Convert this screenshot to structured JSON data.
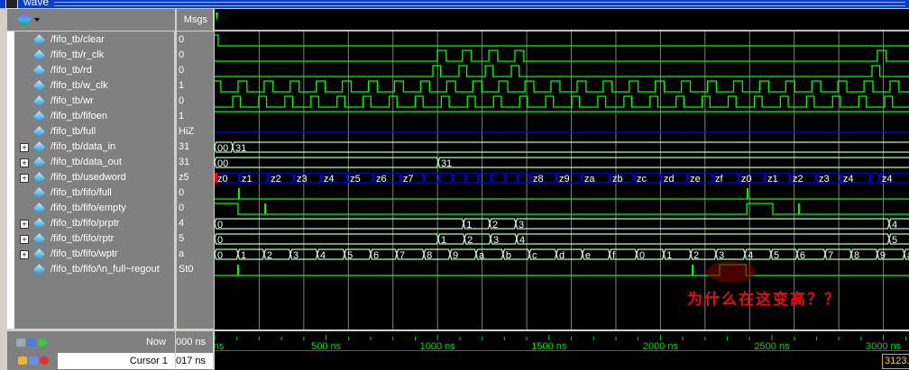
{
  "window": {
    "title": "wave"
  },
  "header": {
    "msgs_label": "Msgs"
  },
  "signals": [
    {
      "name": "/fifo_tb/clear",
      "value": "0",
      "expandable": false
    },
    {
      "name": "/fifo_tb/r_clk",
      "value": "0",
      "expandable": false
    },
    {
      "name": "/fifo_tb/rd",
      "value": "0",
      "expandable": false
    },
    {
      "name": "/fifo_tb/w_clk",
      "value": "1",
      "expandable": false
    },
    {
      "name": "/fifo_tb/wr",
      "value": "0",
      "expandable": false
    },
    {
      "name": "/fifo_tb/fifoen",
      "value": "1",
      "expandable": false
    },
    {
      "name": "/fifo_tb/full",
      "value": "HiZ",
      "expandable": false
    },
    {
      "name": "/fifo_tb/data_in",
      "value": "31",
      "expandable": true
    },
    {
      "name": "/fifo_tb/data_out",
      "value": "31",
      "expandable": true
    },
    {
      "name": "/fifo_tb/usedword",
      "value": "z5",
      "expandable": true
    },
    {
      "name": "/fifo_tb/fifo/full",
      "value": "0",
      "expandable": false
    },
    {
      "name": "/fifo_tb/fifo/empty",
      "value": "0",
      "expandable": false
    },
    {
      "name": "/fifo_tb/fifo/prptr",
      "value": "4",
      "expandable": true
    },
    {
      "name": "/fifo_tb/fifo/rptr",
      "value": "5",
      "expandable": true
    },
    {
      "name": "/fifo_tb/fifo/wptr",
      "value": "a",
      "expandable": true
    },
    {
      "name": "/fifo_tb/fifo/\\n_full~regout",
      "value": "St0",
      "expandable": false
    }
  ],
  "waves": [
    {
      "type": "bit",
      "transitions": [
        [
          0,
          1
        ],
        [
          16,
          0
        ]
      ]
    },
    {
      "type": "pulses",
      "starts": [
        999,
        1112,
        1230,
        1347,
        2973
      ],
      "width": 40,
      "extra_end": 3080
    },
    {
      "type": "pulses",
      "starts": [
        979,
        1096,
        1214,
        1331,
        2949
      ],
      "width": 35
    },
    {
      "type": "clock",
      "offset": 105,
      "period": 117,
      "high": 40,
      "start_high": true
    },
    {
      "type": "clock",
      "offset": 81,
      "period": 117,
      "high": 35
    },
    {
      "type": "bit",
      "transitions": [
        [
          0,
          1
        ]
      ]
    },
    {
      "type": "hiz"
    },
    {
      "type": "bus",
      "segments": [
        [
          0,
          "00"
        ],
        [
          81,
          "31"
        ]
      ]
    },
    {
      "type": "bus",
      "segments": [
        [
          0,
          "00"
        ],
        [
          1003,
          "31"
        ]
      ]
    },
    {
      "type": "bus",
      "color": "#0000ff",
      "segments": [
        [
          0,
          "z0"
        ],
        [
          109,
          "z1"
        ],
        [
          239,
          "z2"
        ],
        [
          356,
          "z3"
        ],
        [
          477,
          "z4"
        ],
        [
          595,
          "z5"
        ],
        [
          712,
          "z6"
        ],
        [
          833,
          "z7"
        ],
        [
          939,
          ""
        ],
        [
          1007,
          ""
        ],
        [
          1068,
          ""
        ],
        [
          1125,
          ""
        ],
        [
          1185,
          ""
        ],
        [
          1242,
          ""
        ],
        [
          1303,
          ""
        ],
        [
          1359,
          ""
        ],
        [
          1416,
          "z8"
        ],
        [
          1533,
          "z9"
        ],
        [
          1646,
          "za"
        ],
        [
          1772,
          "zb"
        ],
        [
          1881,
          "zc"
        ],
        [
          2002,
          "zd"
        ],
        [
          2120,
          "ze"
        ],
        [
          2233,
          "zf"
        ],
        [
          2350,
          "z0"
        ],
        [
          2468,
          "z1"
        ],
        [
          2581,
          "z2"
        ],
        [
          2698,
          "z3"
        ],
        [
          2807,
          "z4"
        ],
        [
          2941,
          ""
        ],
        [
          2981,
          "z4"
        ]
      ]
    },
    {
      "type": "bit",
      "transitions": [
        [
          0,
          0
        ]
      ],
      "spikes": [
        109,
        2391
      ]
    },
    {
      "type": "bit",
      "transitions": [
        [
          0,
          1
        ],
        [
          105,
          0
        ],
        [
          2387,
          1
        ],
        [
          2504,
          0
        ]
      ],
      "spikes": [
        227,
        2621
      ]
    },
    {
      "type": "bus",
      "segments": [
        [
          0,
          "0"
        ],
        [
          1117,
          "1"
        ],
        [
          1234,
          "2"
        ],
        [
          1351,
          "3"
        ],
        [
          3026,
          "4"
        ]
      ]
    },
    {
      "type": "bus",
      "segments": [
        [
          0,
          "0"
        ],
        [
          1003,
          "1"
        ],
        [
          1121,
          "2"
        ],
        [
          1238,
          "3"
        ],
        [
          1355,
          "4"
        ],
        [
          3026,
          "5"
        ]
      ]
    },
    {
      "type": "bus",
      "segments": [
        [
          0,
          "0"
        ],
        [
          105,
          "1"
        ],
        [
          222,
          "2"
        ],
        [
          340,
          "3"
        ],
        [
          461,
          "4"
        ],
        [
          583,
          "5"
        ],
        [
          700,
          "6"
        ],
        [
          817,
          "7"
        ],
        [
          939,
          "8"
        ],
        [
          1056,
          "9"
        ],
        [
          1173,
          "a"
        ],
        [
          1294,
          "b"
        ],
        [
          1412,
          "c"
        ],
        [
          1533,
          "d"
        ],
        [
          1650,
          "e"
        ],
        [
          1772,
          "f"
        ],
        [
          1893,
          "0"
        ],
        [
          2015,
          "1"
        ],
        [
          2136,
          "2"
        ],
        [
          2249,
          "3"
        ],
        [
          2379,
          "4"
        ],
        [
          2496,
          "5"
        ],
        [
          2613,
          "6"
        ],
        [
          2739,
          "7"
        ],
        [
          2856,
          "8"
        ],
        [
          2973,
          "9"
        ],
        [
          3094,
          "a"
        ]
      ]
    },
    {
      "type": "bit",
      "transitions": [
        [
          0,
          0
        ],
        [
          2265,
          1
        ],
        [
          2383,
          0
        ]
      ],
      "spikes": [
        105,
        2144
      ]
    }
  ],
  "timeline": {
    "unit": "ns",
    "ticks": [
      "0 ns",
      "500 ns",
      "1000 ns",
      "1500 ns",
      "2000 ns",
      "2500 ns",
      "3000 ns"
    ],
    "tick_values": [
      0,
      500,
      1000,
      1500,
      2000,
      2500,
      3000
    ],
    "grid_step": 200,
    "now_label": "Now",
    "now_value": "000 ns",
    "cursor_label": "Cursor 1",
    "cursor_value": "017 ns",
    "cursor_marker": "3123.0"
  },
  "annotation": {
    "text": "为什么在这变高？？",
    "color": "#e01010"
  },
  "colors": {
    "wave": "#00ff00",
    "bus": "#b8f8b8",
    "hiz": "#0000ff",
    "grid": "#808080",
    "tick": "#00e000"
  }
}
